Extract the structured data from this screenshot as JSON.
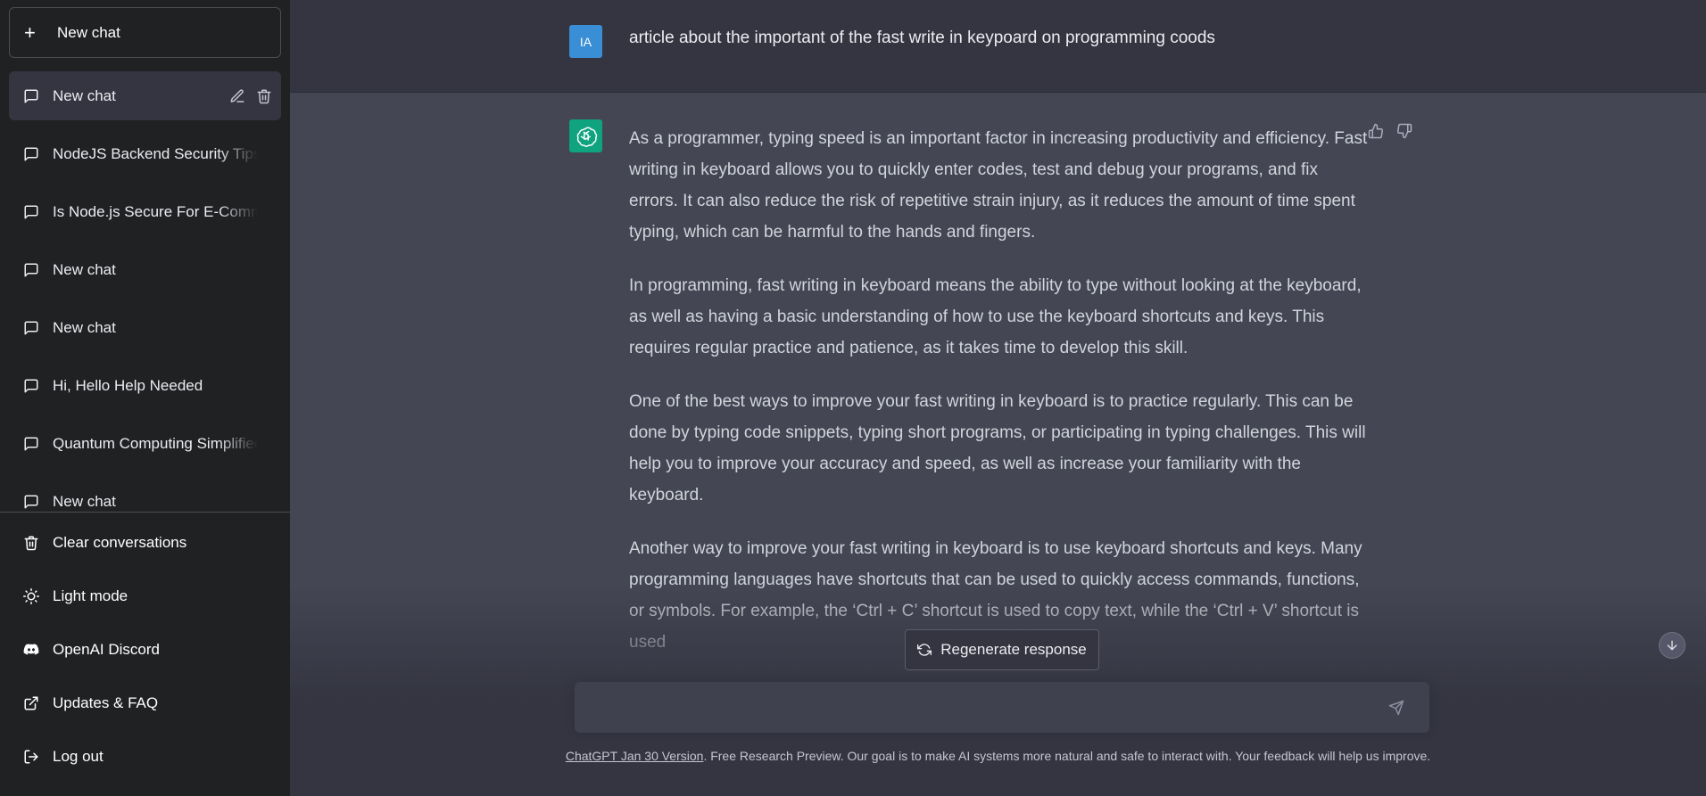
{
  "sidebar": {
    "new_chat_label": "New chat",
    "chats": [
      {
        "label": "New chat"
      },
      {
        "label": "NodeJS Backend Security Tips"
      },
      {
        "label": "Is Node.js Secure For E-Commerce"
      },
      {
        "label": "New chat"
      },
      {
        "label": "New chat"
      },
      {
        "label": "Hi, Hello Help Needed"
      },
      {
        "label": "Quantum Computing Simplified"
      },
      {
        "label": "New chat"
      }
    ],
    "bottom": {
      "clear": "Clear conversations",
      "light_mode": "Light mode",
      "discord": "OpenAI Discord",
      "updates": "Updates & FAQ",
      "logout": "Log out"
    }
  },
  "conversation": {
    "user_initials": "IA",
    "user_message": "article about the important of the fast write in keypoard on programming coods",
    "answer_paragraphs": [
      "As a programmer, typing speed is an important factor in increasing productivity and efficiency. Fast writing in keyboard allows you to quickly enter codes, test and debug your programs, and fix errors. It can also reduce the risk of repetitive strain injury, as it reduces the amount of time spent typing, which can be harmful to the hands and fingers.",
      "In programming, fast writing in keyboard means the ability to type without looking at the keyboard, as well as having a basic understanding of how to use the keyboard shortcuts and keys. This requires regular practice and patience, as it takes time to develop this skill.",
      "One of the best ways to improve your fast writing in keyboard is to practice regularly. This can be done by typing code snippets, typing short programs, or participating in typing challenges. This will help you to improve your accuracy and speed, as well as increase your familiarity with the keyboard.",
      "Another way to improve your fast writing in keyboard is to use keyboard shortcuts and keys. Many programming languages have shortcuts that can be used to quickly access commands, functions, or symbols. For example, the ‘Ctrl + C’ shortcut is used to copy text, while the ‘Ctrl + V’ shortcut is used"
    ]
  },
  "controls": {
    "regenerate_label": "Regenerate response",
    "input_value": "",
    "input_placeholder": ""
  },
  "footer": {
    "version_link": "ChatGPT Jan 30 Version",
    "text": ". Free Research Preview. Our goal is to make AI systems more natural and safe to interact with. Your feedback will help us improve."
  },
  "colors": {
    "sidebar_bg": "#202123",
    "main_bg": "#343541",
    "assistant_bg": "#444654",
    "gpt_avatar": "#10a37f",
    "user_avatar": "#3a8ed6"
  },
  "icons": {
    "new_chat": "plus-icon",
    "chat": "chat-bubble-icon",
    "edit": "pencil-icon",
    "delete": "trash-icon",
    "clear": "trash-icon",
    "light_mode": "sun-icon",
    "discord": "discord-icon",
    "updates": "external-link-icon",
    "logout": "logout-icon",
    "thumbs_up": "thumbs-up-icon",
    "thumbs_down": "thumbs-down-icon",
    "regenerate": "refresh-icon",
    "scroll": "arrow-down-icon",
    "send": "send-icon"
  }
}
